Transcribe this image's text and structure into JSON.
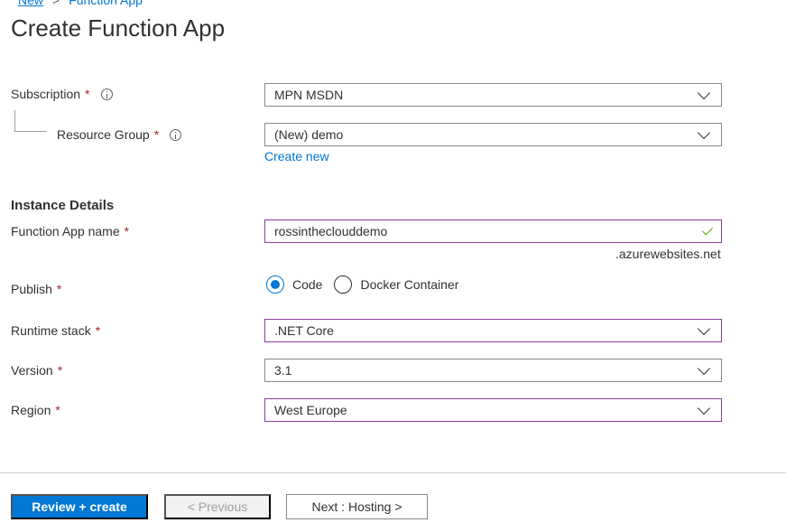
{
  "breadcrumb": {
    "items": [
      "New",
      "Function App"
    ]
  },
  "page": {
    "title": "Create Function App"
  },
  "fields": {
    "subscription": {
      "label": "Subscription",
      "required": "*",
      "value": "MPN MSDN"
    },
    "resource_group": {
      "label": "Resource Group",
      "required": "*",
      "value": "(New) demo",
      "create_new": "Create new"
    },
    "instance_heading": "Instance Details",
    "function_app_name": {
      "label": "Function App name",
      "required": "*",
      "value": "rossintheclouddemo",
      "suffix": ".azurewebsites.net"
    },
    "publish": {
      "label": "Publish",
      "required": "*",
      "options": [
        "Code",
        "Docker Container"
      ],
      "selected": "Code"
    },
    "runtime_stack": {
      "label": "Runtime stack",
      "required": "*",
      "value": ".NET Core"
    },
    "version": {
      "label": "Version",
      "required": "*",
      "value": "3.1"
    },
    "region": {
      "label": "Region",
      "required": "*",
      "value": "West Europe"
    }
  },
  "footer": {
    "review_create": "Review + create",
    "previous": "< Previous",
    "next": "Next : Hosting >"
  },
  "colors": {
    "accent": "#0078d4",
    "required": "#a4262c",
    "valid_check": "#57a300",
    "focus_border": "#8a3ea2"
  }
}
